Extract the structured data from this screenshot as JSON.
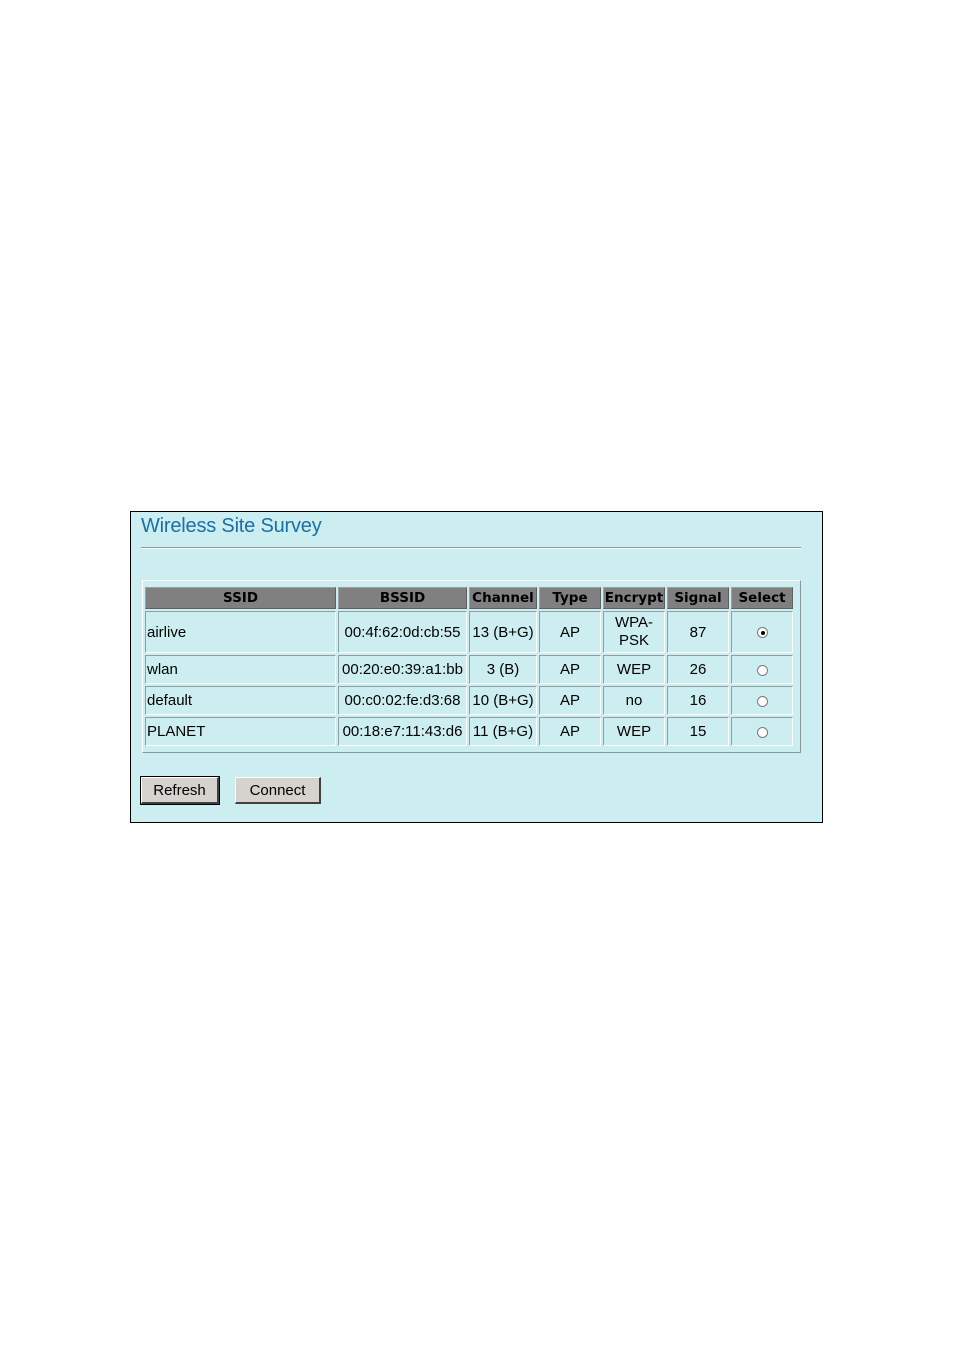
{
  "page": {
    "title": "Wireless Site Survey"
  },
  "table": {
    "headers": [
      "SSID",
      "BSSID",
      "Channel",
      "Type",
      "Encrypt",
      "Signal",
      "Select"
    ],
    "rows": [
      {
        "ssid": "airlive",
        "bssid": "00:4f:62:0d:cb:55",
        "channel": "13 (B+G)",
        "type": "AP",
        "encrypt_line1": "WPA-",
        "encrypt_line2": "PSK",
        "signal": "87",
        "selected": true
      },
      {
        "ssid": "wlan",
        "bssid": "00:20:e0:39:a1:bb",
        "channel": "3 (B)",
        "type": "AP",
        "encrypt": "WEP",
        "signal": "26",
        "selected": false
      },
      {
        "ssid": "default",
        "bssid": "00:c0:02:fe:d3:68",
        "channel": "10 (B+G)",
        "type": "AP",
        "encrypt": "no",
        "signal": "16",
        "selected": false
      },
      {
        "ssid": "PLANET",
        "bssid": "00:18:e7:11:43:d6",
        "channel": "11 (B+G)",
        "type": "AP",
        "encrypt": "WEP",
        "signal": "15",
        "selected": false
      }
    ]
  },
  "buttons": {
    "refresh": "Refresh",
    "connect": "Connect"
  }
}
